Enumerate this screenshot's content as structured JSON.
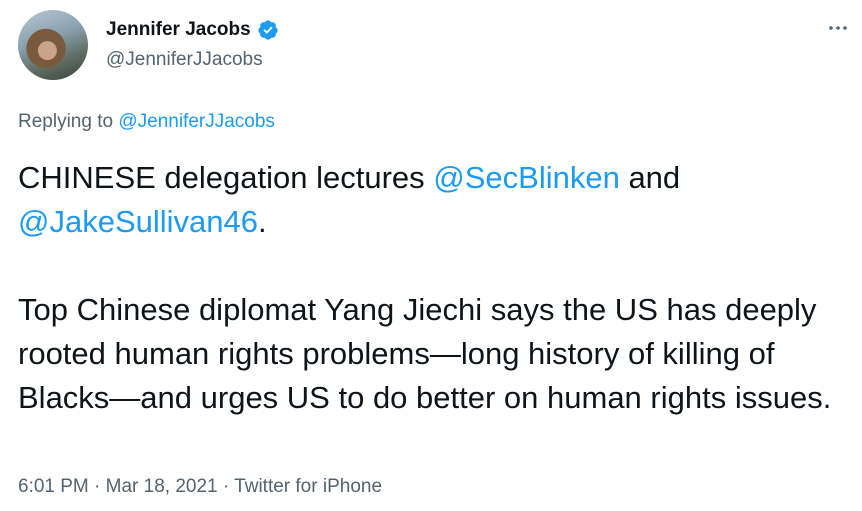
{
  "author": {
    "name": "Jennifer Jacobs",
    "handle": "@JenniferJJacobs",
    "verified_icon": "verified-badge-icon",
    "accent_color": "#1d9bf0"
  },
  "menu_icon": "more-horizontal-icon",
  "reply": {
    "prefix": "Replying to",
    "to": "@JenniferJJacobs"
  },
  "tweet": {
    "p1_text_a": "CHINESE delegation lectures ",
    "p1_mention_1": "@SecBlinken",
    "p1_text_b": " and",
    "p1_mention_2": "@JakeSullivan46",
    "p1_text_c": ".",
    "p2": "Top Chinese diplomat Yang Jiechi says the US has deeply rooted human rights problems—long history of killing of Blacks—and urges US to do better on human rights issues."
  },
  "meta": {
    "time": "6:01 PM",
    "sep1": " · ",
    "date": "Mar 18, 2021",
    "sep2": " · ",
    "source": "Twitter for iPhone"
  }
}
